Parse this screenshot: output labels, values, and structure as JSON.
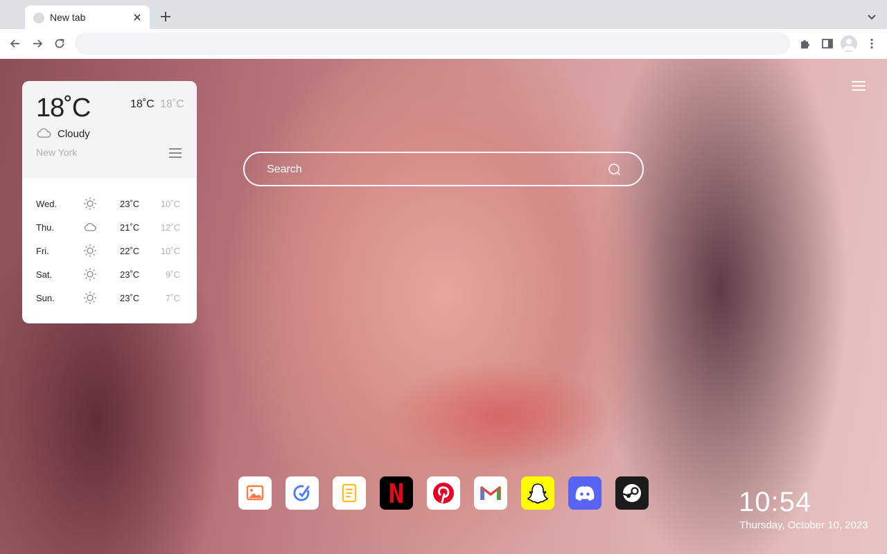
{
  "browser": {
    "tab": {
      "title": "New tab"
    },
    "address_bar": {
      "value": "",
      "placeholder": ""
    }
  },
  "weather": {
    "current_temp": "18˚C",
    "high": "18˚C",
    "low": "18˚C",
    "condition": "Cloudy",
    "condition_icon": "cloud-icon",
    "city": "New York",
    "forecast": [
      {
        "day": "Wed.",
        "icon": "sun-icon",
        "high": "23˚C",
        "low": "10˚C"
      },
      {
        "day": "Thu.",
        "icon": "cloud-icon",
        "high": "21˚C",
        "low": "12˚C"
      },
      {
        "day": "Fri.",
        "icon": "sun-icon",
        "high": "22˚C",
        "low": "10˚C"
      },
      {
        "day": "Sat.",
        "icon": "sun-icon",
        "high": "23˚C",
        "low": "9˚C"
      },
      {
        "day": "Sun.",
        "icon": "sun-icon",
        "high": "23˚C",
        "low": "7˚C"
      }
    ]
  },
  "search": {
    "placeholder": "Search"
  },
  "dock": {
    "apps": [
      {
        "name": "photos",
        "icon": "photo-icon",
        "color": "#ff7a45"
      },
      {
        "name": "todo",
        "icon": "check-circle-icon",
        "color": "#4f7cf7"
      },
      {
        "name": "notes",
        "icon": "note-icon",
        "color": "#f5c02b"
      },
      {
        "name": "netflix",
        "icon": "netflix-icon",
        "color": "#e50914"
      },
      {
        "name": "pinterest",
        "icon": "pinterest-icon",
        "color": "#e60023"
      },
      {
        "name": "gmail",
        "icon": "gmail-icon",
        "color": "#ea4335"
      },
      {
        "name": "snapchat",
        "icon": "snapchat-icon",
        "color": "#fffc00"
      },
      {
        "name": "discord",
        "icon": "discord-icon",
        "color": "#5865f2"
      },
      {
        "name": "steam",
        "icon": "steam-icon",
        "color": "#171a21"
      }
    ]
  },
  "clock": {
    "time": "10:54",
    "date": "Thursday, October 10, 2023"
  }
}
